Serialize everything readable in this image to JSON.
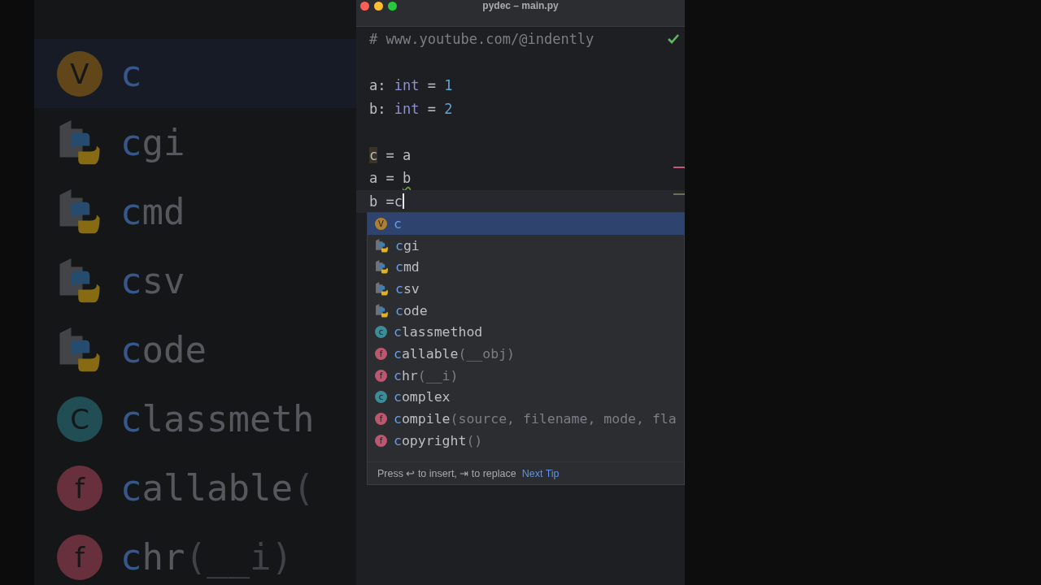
{
  "backdrop": {
    "items": [
      {
        "kind": "variable",
        "badge": "V",
        "match": "c",
        "selected": true
      },
      {
        "kind": "module",
        "match": "c",
        "rest": "gi",
        "selected": false
      },
      {
        "kind": "module",
        "match": "c",
        "rest": "md",
        "selected": false
      },
      {
        "kind": "module",
        "match": "c",
        "rest": "sv",
        "selected": false
      },
      {
        "kind": "module",
        "match": "c",
        "rest": "ode",
        "selected": false
      },
      {
        "kind": "class",
        "badge": "C",
        "match": "c",
        "rest": "lassmeth",
        "selected": false
      },
      {
        "kind": "function",
        "badge": "f",
        "match": "c",
        "rest": "allable",
        "signature": "(",
        "selected": false
      },
      {
        "kind": "function",
        "badge": "f",
        "match": "c",
        "rest": "hr",
        "signature": "(__i)",
        "selected": false
      }
    ]
  },
  "window": {
    "title": "pydec – main.py"
  },
  "editor": {
    "lines": [
      {
        "kind": "code",
        "tokens": [
          {
            "kind": "comment",
            "text": "# www.youtube.com/@indently"
          }
        ]
      },
      {
        "kind": "blank"
      },
      {
        "kind": "code",
        "tokens": [
          {
            "kind": "plain",
            "text": "a: "
          },
          {
            "kind": "keyword",
            "text": "int"
          },
          {
            "kind": "plain",
            "text": " = "
          },
          {
            "kind": "number",
            "text": "1"
          }
        ]
      },
      {
        "kind": "code",
        "tokens": [
          {
            "kind": "plain",
            "text": "b: "
          },
          {
            "kind": "keyword",
            "text": "int"
          },
          {
            "kind": "plain",
            "text": " = "
          },
          {
            "kind": "number",
            "text": "2"
          }
        ]
      },
      {
        "kind": "blank"
      },
      {
        "kind": "code",
        "tokens": [
          {
            "kind": "usage",
            "text": "c"
          },
          {
            "kind": "plain",
            "text": " = a"
          }
        ]
      },
      {
        "kind": "code",
        "current": false,
        "error_mark": true,
        "warning_mark": false,
        "tokens": [
          {
            "kind": "plain",
            "text": "a = "
          },
          {
            "kind": "weak_warning",
            "text": "b"
          }
        ]
      },
      {
        "kind": "code",
        "current": true,
        "error_mark": false,
        "warning_mark": true,
        "tokens": [
          {
            "kind": "plain",
            "text": "b ="
          },
          {
            "kind": "typed",
            "text": "c"
          }
        ]
      }
    ]
  },
  "completion": {
    "items": [
      {
        "kind": "variable",
        "badge": "V",
        "match": "c",
        "selected": true
      },
      {
        "kind": "module",
        "match": "c",
        "rest": "gi",
        "selected": false
      },
      {
        "kind": "module",
        "match": "c",
        "rest": "md",
        "selected": false
      },
      {
        "kind": "module",
        "match": "c",
        "rest": "sv",
        "selected": false
      },
      {
        "kind": "module",
        "match": "c",
        "rest": "ode",
        "selected": false
      },
      {
        "kind": "class",
        "badge": "c",
        "match": "c",
        "rest": "lassmethod",
        "selected": false
      },
      {
        "kind": "function",
        "badge": "f",
        "match": "c",
        "rest": "allable",
        "signature": "(__obj)",
        "selected": false
      },
      {
        "kind": "function",
        "badge": "f",
        "match": "c",
        "rest": "hr",
        "signature": "(__i)",
        "selected": false
      },
      {
        "kind": "class",
        "badge": "c",
        "match": "c",
        "rest": "omplex",
        "selected": false
      },
      {
        "kind": "function",
        "badge": "f",
        "match": "c",
        "rest": "ompile",
        "signature": "(source, filename, mode, fla",
        "selected": false
      },
      {
        "kind": "function",
        "badge": "f",
        "match": "c",
        "rest": "opyright",
        "signature": "()",
        "selected": false
      }
    ],
    "hint": "Press ↩ to insert, ⇥ to replace",
    "link": "Next Tip"
  }
}
